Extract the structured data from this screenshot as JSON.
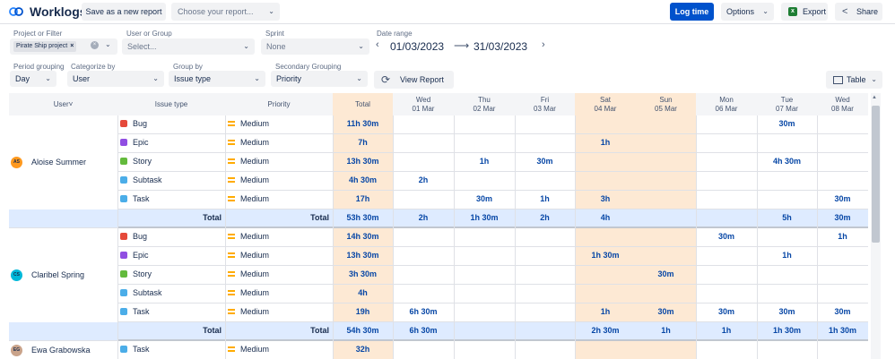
{
  "app": {
    "title": "Worklogs"
  },
  "toolbar": {
    "save_label": "Save as a new report",
    "report_placeholder": "Choose your report...",
    "log_time_label": "Log time",
    "options_label": "Options",
    "export_label": "Export",
    "share_label": "Share"
  },
  "filters": {
    "project_label": "Project or Filter",
    "project_tag": "Pirate Ship project",
    "user_label": "User or Group",
    "user_placeholder": "Select...",
    "sprint_label": "Sprint",
    "sprint_value": "None",
    "date_label": "Date range",
    "date_from": "01/03/2023",
    "date_to": "31/03/2023",
    "period_label": "Period grouping",
    "period_value": "Day",
    "categorize_label": "Categorize by",
    "categorize_value": "User",
    "group_label": "Group by",
    "group_value": "Issue type",
    "secondary_label": "Secondary Grouping",
    "secondary_value": "Priority",
    "view_report_label": "View Report",
    "table_label": "Table"
  },
  "colors": {
    "bug": "#e5493a",
    "epic": "#904ee2",
    "story": "#63ba3c",
    "subtask": "#4bade8",
    "task": "#4bade8",
    "accent": "#0052cc",
    "weekend": "#fde9d4",
    "total_row": "#deebff"
  },
  "grid": {
    "headers": {
      "user": "User",
      "sort_icon": "˅",
      "issue_type": "Issue type",
      "priority": "Priority",
      "total": "Total"
    },
    "days": [
      {
        "dow": "Wed",
        "date": "01 Mar"
      },
      {
        "dow": "Thu",
        "date": "02 Mar"
      },
      {
        "dow": "Fri",
        "date": "03 Mar"
      },
      {
        "dow": "Sat",
        "date": "04 Mar"
      },
      {
        "dow": "Sun",
        "date": "05 Mar"
      },
      {
        "dow": "Mon",
        "date": "06 Mar"
      },
      {
        "dow": "Tue",
        "date": "07 Mar"
      },
      {
        "dow": "Wed",
        "date": "08 Mar"
      }
    ],
    "users": [
      {
        "initials": "AS",
        "name": "Aloise Summer",
        "rows": [
          {
            "type": "Bug",
            "icon": "bug",
            "priority": "Medium",
            "total": "11h 30m",
            "days": [
              "",
              "",
              "",
              "",
              "",
              "",
              "30m",
              ""
            ]
          },
          {
            "type": "Epic",
            "icon": "epic",
            "priority": "Medium",
            "total": "7h",
            "days": [
              "",
              "",
              "",
              "1h",
              "",
              "",
              "",
              ""
            ]
          },
          {
            "type": "Story",
            "icon": "story",
            "priority": "Medium",
            "total": "13h 30m",
            "days": [
              "",
              "1h",
              "30m",
              "",
              "",
              "",
              "4h 30m",
              ""
            ]
          },
          {
            "type": "Subtask",
            "icon": "subtask",
            "priority": "Medium",
            "total": "4h 30m",
            "days": [
              "2h",
              "",
              "",
              "",
              "",
              "",
              "",
              ""
            ]
          },
          {
            "type": "Task",
            "icon": "task",
            "priority": "Medium",
            "total": "17h",
            "days": [
              "",
              "30m",
              "1h",
              "3h",
              "",
              "",
              "",
              "30m"
            ]
          }
        ],
        "total_label": "Total",
        "total_label2": "Total",
        "total": {
          "total": "53h 30m",
          "days": [
            "2h",
            "1h 30m",
            "2h",
            "4h",
            "",
            "",
            "5h",
            "30m"
          ]
        }
      },
      {
        "initials": "CS",
        "name": "Claribel Spring",
        "rows": [
          {
            "type": "Bug",
            "icon": "bug",
            "priority": "Medium",
            "total": "14h 30m",
            "days": [
              "",
              "",
              "",
              "",
              "",
              "30m",
              "",
              "1h"
            ]
          },
          {
            "type": "Epic",
            "icon": "epic",
            "priority": "Medium",
            "total": "13h 30m",
            "days": [
              "",
              "",
              "",
              "1h 30m",
              "",
              "",
              "1h",
              ""
            ]
          },
          {
            "type": "Story",
            "icon": "story",
            "priority": "Medium",
            "total": "3h 30m",
            "days": [
              "",
              "",
              "",
              "",
              "30m",
              "",
              "",
              ""
            ]
          },
          {
            "type": "Subtask",
            "icon": "subtask",
            "priority": "Medium",
            "total": "4h",
            "days": [
              "",
              "",
              "",
              "",
              "",
              "",
              "",
              ""
            ]
          },
          {
            "type": "Task",
            "icon": "task",
            "priority": "Medium",
            "total": "19h",
            "days": [
              "6h 30m",
              "",
              "",
              "1h",
              "30m",
              "30m",
              "30m",
              "30m"
            ]
          }
        ],
        "total_label": "Total",
        "total_label2": "Total",
        "total": {
          "total": "54h 30m",
          "days": [
            "6h 30m",
            "",
            "",
            "2h 30m",
            "1h",
            "1h",
            "1h 30m",
            "1h 30m"
          ]
        }
      },
      {
        "initials": "EG",
        "name": "Ewa Grabowska",
        "rows": [
          {
            "type": "Task",
            "icon": "task",
            "priority": "Medium",
            "total": "32h",
            "days": [
              "",
              "",
              "",
              "",
              "",
              "",
              "",
              ""
            ]
          }
        ]
      }
    ]
  }
}
